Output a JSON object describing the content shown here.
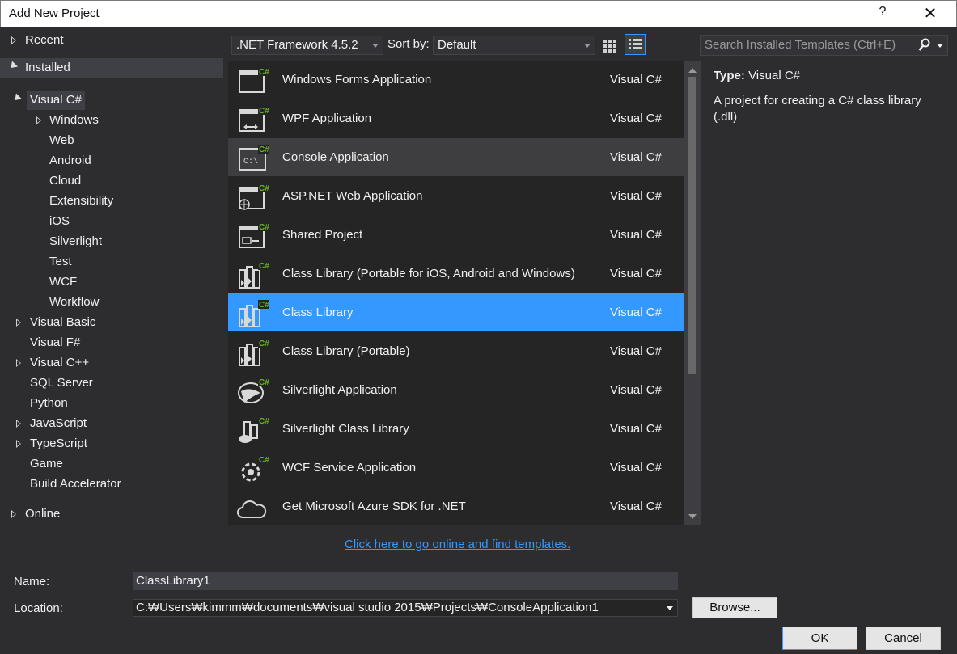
{
  "window": {
    "title": "Add New Project",
    "help_label": "?",
    "close_label": "✕"
  },
  "tree": {
    "recent": "Recent",
    "installed": "Installed",
    "visual_csharp": "Visual C#",
    "csharp_children": [
      "Windows",
      "Web",
      "Android",
      "Cloud",
      "Extensibility",
      "iOS",
      "Silverlight",
      "Test",
      "WCF",
      "Workflow"
    ],
    "visual_basic": "Visual Basic",
    "visual_fsharp": "Visual F#",
    "visual_cpp": "Visual C++",
    "sql_server": "SQL Server",
    "python": "Python",
    "javascript": "JavaScript",
    "typescript": "TypeScript",
    "game": "Game",
    "build_accelerator": "Build Accelerator",
    "online": "Online"
  },
  "toolbar": {
    "framework": ".NET Framework 4.5.2",
    "sort_label": "Sort by:",
    "sort_value": "Default",
    "search_placeholder": "Search Installed Templates (Ctrl+E)"
  },
  "templates": [
    {
      "name": "Windows Forms Application",
      "lang": "Visual C#",
      "icon": "windows-forms-icon"
    },
    {
      "name": "WPF Application",
      "lang": "Visual C#",
      "icon": "wpf-icon"
    },
    {
      "name": "Console Application",
      "lang": "Visual C#",
      "icon": "console-icon"
    },
    {
      "name": "ASP.NET Web Application",
      "lang": "Visual C#",
      "icon": "web-app-icon"
    },
    {
      "name": "Shared Project",
      "lang": "Visual C#",
      "icon": "shared-project-icon"
    },
    {
      "name": "Class Library (Portable for iOS, Android and Windows)",
      "lang": "Visual C#",
      "icon": "class-library-icon"
    },
    {
      "name": "Class Library",
      "lang": "Visual C#",
      "icon": "class-library-icon"
    },
    {
      "name": "Class Library (Portable)",
      "lang": "Visual C#",
      "icon": "class-library-icon"
    },
    {
      "name": "Silverlight Application",
      "lang": "Visual C#",
      "icon": "silverlight-icon"
    },
    {
      "name": "Silverlight Class Library",
      "lang": "Visual C#",
      "icon": "silverlight-library-icon"
    },
    {
      "name": "WCF Service Application",
      "lang": "Visual C#",
      "icon": "wcf-icon"
    },
    {
      "name": "Get Microsoft Azure SDK for .NET",
      "lang": "Visual C#",
      "icon": "cloud-icon"
    }
  ],
  "selected_template": "Class Library",
  "details": {
    "type_label": "Type:",
    "type_value": "Visual C#",
    "description": "A project for creating a C# class library (.dll)"
  },
  "online_link": "Click here to go online and find templates.",
  "form": {
    "name_label": "Name:",
    "name_value": "ClassLibrary1",
    "location_label": "Location:",
    "location_value": "C:₩Users₩kimmm₩documents₩visual studio 2015₩Projects₩ConsoleApplication1",
    "browse_label": "Browse...",
    "ok_label": "OK",
    "cancel_label": "Cancel"
  },
  "colors": {
    "accent": "#3399ff",
    "background": "#2d2d30",
    "list_bg": "#252526",
    "csharp_badge": "#68b723"
  }
}
